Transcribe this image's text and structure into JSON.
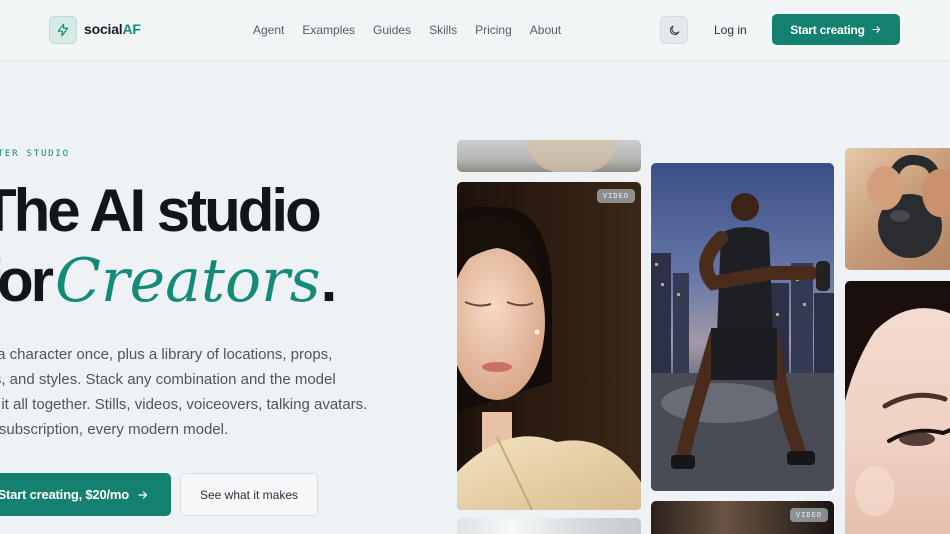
{
  "header": {
    "brand": {
      "prefix": "social",
      "suffix": "AF"
    },
    "nav": [
      "Agent",
      "Examples",
      "Guides",
      "Skills",
      "Pricing",
      "About"
    ],
    "login": "Log in",
    "cta": "Start creating",
    "accent_color": "#14806f"
  },
  "hero": {
    "eyebrow": "RACTER STUDIO",
    "headline_line1": "The AI studio",
    "headline_line2_plain": "for",
    "headline_line2_accent": "Creators",
    "headline_line2_dot": ".",
    "paragraph": [
      "ild a character once, plus a library of locations, props,",
      "tfits, and styles. Stack any combination and the model",
      "lds it all together. Stills, videos, voiceovers, talking avatars.",
      "ne subscription, every modern model."
    ],
    "cta_primary": "Start creating, $20/mo",
    "cta_secondary": "See what it makes"
  },
  "gallery": {
    "badge_video_1": "VIDEO",
    "badge_video_2": "VIDEO"
  }
}
